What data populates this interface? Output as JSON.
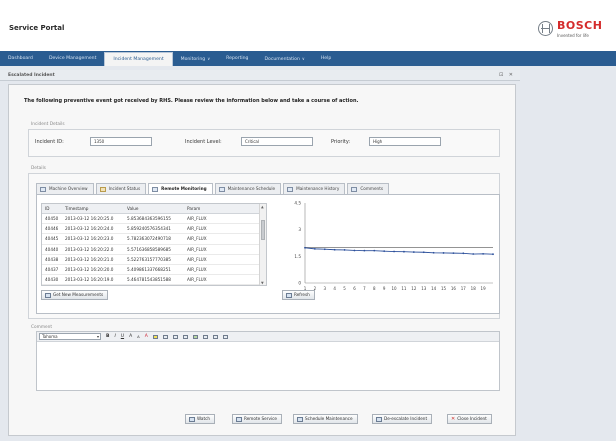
{
  "header": {
    "portal_title": "Service Portal",
    "brand": "BOSCH",
    "brand_tagline": "Invented for life"
  },
  "nav": {
    "items": [
      {
        "label": "Dashboard",
        "dropdown": false,
        "active": false
      },
      {
        "label": "Device Management",
        "dropdown": false,
        "active": false
      },
      {
        "label": "Incident Management",
        "dropdown": false,
        "active": true
      },
      {
        "label": "Monitoring",
        "dropdown": true,
        "active": false
      },
      {
        "label": "Reporting",
        "dropdown": false,
        "active": false
      },
      {
        "label": "Documentation",
        "dropdown": true,
        "active": false
      },
      {
        "label": "Help",
        "dropdown": false,
        "active": false
      }
    ]
  },
  "panel": {
    "title": "Escalated Incident",
    "controls": "⊡ ✕"
  },
  "notice": "The following preventive event got received by RHS. Please review the information below and take a course of action.",
  "incident_details": {
    "section_label": "Incident Details",
    "id_label": "Incident ID:",
    "id_value": "1350",
    "level_label": "Incident Level:",
    "level_value": "Critical",
    "priority_label": "Priority:",
    "priority_value": "High"
  },
  "details": {
    "section_label": "Details",
    "tabs": [
      "Machine Overview",
      "Incident Status",
      "Remote Monitoring",
      "Maintenance Schedule",
      "Maintenance History",
      "Comments"
    ],
    "active_tab": 2
  },
  "measurements": {
    "columns": [
      "ID",
      "Timestamp",
      "Value",
      "Param"
    ],
    "rows": [
      [
        "40450",
        "2013-03-12 16:20:25.0",
        "5.853684363596155",
        "AIR_FLUX"
      ],
      [
        "40446",
        "2013-03-12 16:20:24.0",
        "5.859240576354341",
        "AIR_FLUX"
      ],
      [
        "40445",
        "2013-03-12 16:20:23.0",
        "5.782363072490718",
        "AIR_FLUX"
      ],
      [
        "40440",
        "2013-03-12 16:20:22.0",
        "5.571636858589685",
        "AIR_FLUX"
      ],
      [
        "40438",
        "2013-03-12 16:20:21.0",
        "5.522763157770385",
        "AIR_FLUX"
      ],
      [
        "40437",
        "2013-03-12 16:20:20.0",
        "5.409861337668251",
        "AIR_FLUX"
      ],
      [
        "40430",
        "2013-03-12 16:20:19.0",
        "5.464781543851588",
        "AIR_FLUX"
      ]
    ],
    "get_new_button": "Get New Measurements",
    "refresh_button": "Refresh"
  },
  "chart_data": {
    "type": "line",
    "x": [
      1,
      2,
      3,
      4,
      5,
      6,
      7,
      8,
      9,
      10,
      11,
      12,
      13,
      14,
      15,
      16,
      17,
      18,
      19,
      20
    ],
    "tick_labels": [
      "1",
      "2",
      "3",
      "4",
      "5",
      "6",
      "7",
      "8",
      "9",
      "10",
      "11",
      "12",
      "13",
      "14",
      "15",
      "16",
      "17",
      "18",
      "19"
    ],
    "series": [
      {
        "values": [
          2.0,
          2.0,
          2.0,
          2.0,
          2.0,
          2.0,
          2.0,
          2.0,
          2.0,
          2.0,
          2.0,
          2.0,
          2.0,
          2.0,
          2.0,
          2.0,
          2.0,
          2.0,
          2.0,
          2.0
        ],
        "color": "#555555"
      },
      {
        "values": [
          1.98,
          1.92,
          1.9,
          1.87,
          1.86,
          1.83,
          1.82,
          1.82,
          1.79,
          1.77,
          1.76,
          1.74,
          1.73,
          1.7,
          1.69,
          1.68,
          1.67,
          1.63,
          1.64,
          1.62
        ],
        "color": "#2b4f9b"
      }
    ],
    "y_ticks": [
      "4.5",
      "3",
      "1.5",
      "0"
    ],
    "ylim": [
      0,
      4.5
    ]
  },
  "comment": {
    "section_label": "Comment",
    "font": "Tahoma",
    "toolbar": {
      "bold": "B",
      "italic": "I",
      "underline": "U",
      "grow": "A",
      "shrink": "A",
      "color": "A"
    }
  },
  "actions": {
    "watch": "Watch",
    "remote_service": "Remote Service",
    "schedule_maintenance": "Schedule Maintenance",
    "deescalate": "De-escalate Incident",
    "close": "Close Incident"
  },
  "colors": {
    "nav_bg": "#2a5c91",
    "brand_red": "#d42b2b",
    "series_blue": "#2b4f9b"
  }
}
